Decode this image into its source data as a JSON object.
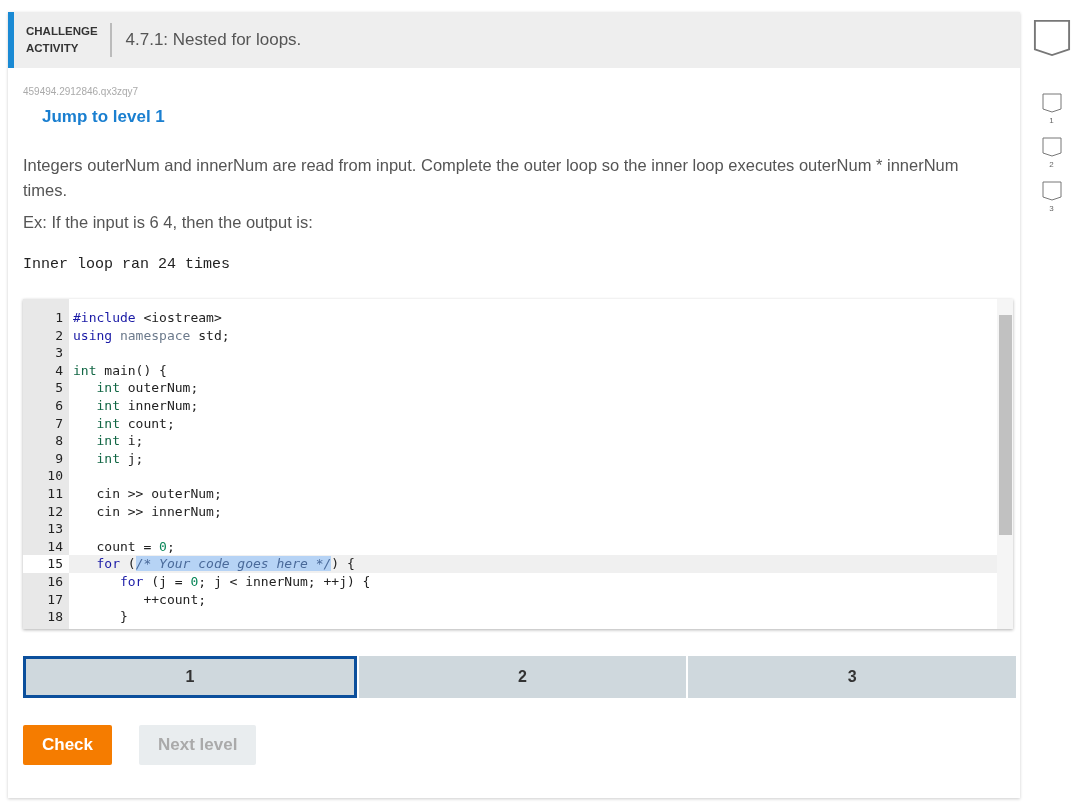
{
  "header": {
    "label_lines": [
      "CHALLENGE",
      "ACTIVITY"
    ],
    "title": "4.7.1: Nested for loops."
  },
  "activity_id": "459494.2912846.qx3zqy7",
  "jump_link": "Jump to level 1",
  "prompt": "Integers outerNum and innerNum are read from input. Complete the outer loop so the inner loop executes outerNum * innerNum times.",
  "example": "Ex: If the input is 6 4, then the output is:",
  "sample_output": "Inner loop ran 24 times",
  "code_lines": [
    {
      "number": "1",
      "active": false,
      "tokens": [
        {
          "kind": "keyword",
          "text": "#include"
        },
        {
          "kind": "plain",
          "text": " <iostream>"
        }
      ]
    },
    {
      "number": "2",
      "active": false,
      "tokens": [
        {
          "kind": "keyword",
          "text": "using"
        },
        {
          "kind": "muted",
          "text": " namespace"
        },
        {
          "kind": "plain",
          "text": " std;"
        }
      ]
    },
    {
      "number": "3",
      "active": false
    },
    {
      "number": "4",
      "active": false,
      "tokens": [
        {
          "kind": "type",
          "text": "int"
        },
        {
          "kind": "plain",
          "text": " main() {"
        }
      ]
    },
    {
      "number": "5",
      "active": false,
      "tokens": [
        {
          "kind": "type",
          "text": "   int"
        },
        {
          "kind": "plain",
          "text": " outerNum;"
        }
      ]
    },
    {
      "number": "6",
      "active": false,
      "tokens": [
        {
          "kind": "type",
          "text": "   int"
        },
        {
          "kind": "plain",
          "text": " innerNum;"
        }
      ]
    },
    {
      "number": "7",
      "active": false,
      "tokens": [
        {
          "kind": "type",
          "text": "   int"
        },
        {
          "kind": "plain",
          "text": " count;"
        }
      ]
    },
    {
      "number": "8",
      "active": false,
      "tokens": [
        {
          "kind": "type",
          "text": "   int"
        },
        {
          "kind": "plain",
          "text": " i;"
        }
      ]
    },
    {
      "number": "9",
      "active": false,
      "tokens": [
        {
          "kind": "type",
          "text": "   int"
        },
        {
          "kind": "plain",
          "text": " j;"
        }
      ]
    },
    {
      "number": "10",
      "active": false
    },
    {
      "number": "11",
      "active": false,
      "tokens": [
        {
          "kind": "plain",
          "text": "   cin >> outerNum;"
        }
      ]
    },
    {
      "number": "12",
      "active": false,
      "tokens": [
        {
          "kind": "plain",
          "text": "   cin >> innerNum;"
        }
      ]
    },
    {
      "number": "13",
      "active": false
    },
    {
      "number": "14",
      "active": false,
      "tokens": [
        {
          "kind": "plain",
          "text": "   count = "
        },
        {
          "kind": "number",
          "text": "0"
        },
        {
          "kind": "plain",
          "text": ";"
        }
      ]
    },
    {
      "number": "15",
      "active": true,
      "tokens": [
        {
          "kind": "keyword",
          "text": "   for"
        },
        {
          "kind": "plain",
          "text": " ("
        },
        {
          "kind": "selected",
          "text": "/* Your code goes here */"
        },
        {
          "kind": "plain",
          "text": ") {"
        }
      ]
    },
    {
      "number": "16",
      "active": false,
      "tokens": [
        {
          "kind": "keyword",
          "text": "      for"
        },
        {
          "kind": "plain",
          "text": " (j = "
        },
        {
          "kind": "number",
          "text": "0"
        },
        {
          "kind": "plain",
          "text": "; j < innerNum; ++j) {"
        }
      ]
    },
    {
      "number": "17",
      "active": false,
      "tokens": [
        {
          "kind": "plain",
          "text": "         ++count;"
        }
      ]
    },
    {
      "number": "18",
      "active": false,
      "tokens": [
        {
          "kind": "plain",
          "text": "      }"
        }
      ]
    }
  ],
  "levels": [
    {
      "label": "1",
      "selected": true
    },
    {
      "label": "2",
      "selected": false
    },
    {
      "label": "3",
      "selected": false
    }
  ],
  "buttons": [
    {
      "label": "Check",
      "disabled": false
    },
    {
      "label": "Next level",
      "disabled": true
    }
  ],
  "level_badges": [
    {
      "label": "1"
    },
    {
      "label": "2"
    },
    {
      "label": "3"
    }
  ]
}
